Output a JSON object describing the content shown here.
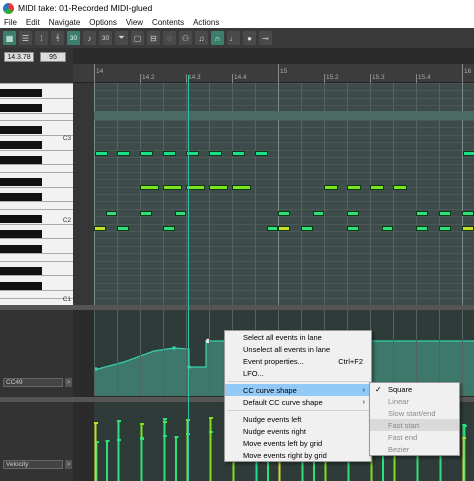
{
  "window": {
    "title": "MIDI take: 01-Recorded MIDI-glued"
  },
  "menubar": [
    "File",
    "Edit",
    "Navigate",
    "Options",
    "View",
    "Contents",
    "Actions"
  ],
  "toolbar": {
    "buttons": [
      {
        "icon": "grid-icon",
        "on": true
      },
      {
        "icon": "list-icon",
        "on": false
      },
      {
        "icon": "dots-icon",
        "on": false
      },
      {
        "icon": "key-icon",
        "on": false
      },
      {
        "icon": "grid30-icon",
        "on": true
      },
      {
        "icon": "note30-icon",
        "on": false
      },
      {
        "icon": "filter30-icon",
        "on": false
      },
      {
        "icon": "funnel-icon",
        "on": false
      },
      {
        "icon": "page-icon",
        "on": false
      },
      {
        "icon": "step-icon",
        "on": false
      },
      {
        "icon": "loop-icon",
        "on": false
      },
      {
        "icon": "nodes-icon",
        "on": false
      },
      {
        "icon": "chord-icon",
        "on": false
      },
      {
        "icon": "magnet-icon",
        "on": true
      },
      {
        "icon": "note-icon",
        "on": false
      },
      {
        "icon": "mic-icon",
        "on": false
      },
      {
        "icon": "tuner-icon",
        "on": false
      }
    ]
  },
  "info": {
    "position": "14.3.78",
    "velocity": "95"
  },
  "ruler": [
    {
      "label": "14",
      "bar": true
    },
    {
      "label": "14.2",
      "bar": false
    },
    {
      "label": "14.3",
      "bar": false
    },
    {
      "label": "14.4",
      "bar": false
    },
    {
      "label": "15",
      "bar": true
    },
    {
      "label": "15.2",
      "bar": false
    },
    {
      "label": "15.3",
      "bar": false
    },
    {
      "label": "15.4",
      "bar": false
    },
    {
      "label": "16",
      "bar": true
    }
  ],
  "keys": {
    "labels": [
      "C3",
      "C2",
      "C1"
    ]
  },
  "notes": [
    {
      "beat": 0.02,
      "len": 0.28,
      "row": 0,
      "color": "#19e08a"
    },
    {
      "beat": 0.5,
      "len": 0.28,
      "row": 0,
      "color": "#19e08a"
    },
    {
      "beat": 1.0,
      "len": 0.28,
      "row": 0,
      "color": "#19e08a"
    },
    {
      "beat": 1.5,
      "len": 0.28,
      "row": 0,
      "color": "#19e08a"
    },
    {
      "beat": 2.0,
      "len": 0.28,
      "row": 0,
      "color": "#19e08a"
    },
    {
      "beat": 2.5,
      "len": 0.28,
      "row": 0,
      "color": "#19e08a"
    },
    {
      "beat": 3.0,
      "len": 0.28,
      "row": 0,
      "color": "#19e08a"
    },
    {
      "beat": 3.5,
      "len": 0.28,
      "row": 0,
      "color": "#19e08a"
    },
    {
      "beat": 8.02,
      "len": 0.28,
      "row": 0,
      "color": "#19e08a"
    },
    {
      "beat": 1.0,
      "len": 0.42,
      "row": 1,
      "color": "#7be31f"
    },
    {
      "beat": 1.5,
      "len": 0.42,
      "row": 1,
      "color": "#7be31f"
    },
    {
      "beat": 2.0,
      "len": 0.42,
      "row": 1,
      "color": "#7be31f"
    },
    {
      "beat": 2.5,
      "len": 0.42,
      "row": 1,
      "color": "#7be31f"
    },
    {
      "beat": 3.0,
      "len": 0.42,
      "row": 1,
      "color": "#7be31f"
    },
    {
      "beat": 5.0,
      "len": 0.3,
      "row": 1,
      "color": "#7be31f"
    },
    {
      "beat": 5.5,
      "len": 0.3,
      "row": 1,
      "color": "#7be31f"
    },
    {
      "beat": 6.0,
      "len": 0.3,
      "row": 1,
      "color": "#7be31f"
    },
    {
      "beat": 6.5,
      "len": 0.3,
      "row": 1,
      "color": "#7be31f"
    },
    {
      "beat": 0.25,
      "len": 0.25,
      "row": 2,
      "color": "#2fe07a"
    },
    {
      "beat": 1.0,
      "len": 0.25,
      "row": 2,
      "color": "#2fe07a"
    },
    {
      "beat": 1.75,
      "len": 0.25,
      "row": 2,
      "color": "#2fe07a"
    },
    {
      "beat": 4.0,
      "len": 0.25,
      "row": 2,
      "color": "#2fe07a"
    },
    {
      "beat": 4.75,
      "len": 0.25,
      "row": 2,
      "color": "#2fe07a"
    },
    {
      "beat": 5.5,
      "len": 0.25,
      "row": 2,
      "color": "#2fe07a"
    },
    {
      "beat": 7.0,
      "len": 0.25,
      "row": 2,
      "color": "#2fe07a"
    },
    {
      "beat": 7.5,
      "len": 0.25,
      "row": 2,
      "color": "#2fe07a"
    },
    {
      "beat": 8.0,
      "len": 0.25,
      "row": 2,
      "color": "#2fe07a"
    },
    {
      "beat": 0.0,
      "len": 0.25,
      "row": 3,
      "color": "#c8df2a"
    },
    {
      "beat": 0.5,
      "len": 0.25,
      "row": 3,
      "color": "#2fe07a"
    },
    {
      "beat": 1.5,
      "len": 0.25,
      "row": 3,
      "color": "#2fe07a"
    },
    {
      "beat": 3.75,
      "len": 0.25,
      "row": 3,
      "color": "#2fe07a"
    },
    {
      "beat": 4.0,
      "len": 0.25,
      "row": 3,
      "color": "#c8df2a"
    },
    {
      "beat": 4.5,
      "len": 0.25,
      "row": 3,
      "color": "#2fe07a"
    },
    {
      "beat": 5.5,
      "len": 0.25,
      "row": 3,
      "color": "#2fe07a"
    },
    {
      "beat": 6.25,
      "len": 0.25,
      "row": 3,
      "color": "#2fe07a"
    },
    {
      "beat": 7.0,
      "len": 0.25,
      "row": 3,
      "color": "#2fe07a"
    },
    {
      "beat": 7.5,
      "len": 0.25,
      "row": 3,
      "color": "#2fe07a"
    },
    {
      "beat": 8.0,
      "len": 0.25,
      "row": 3,
      "color": "#c8df2a"
    }
  ],
  "cc_lane": {
    "label": "CC49",
    "arrow": ">"
  },
  "velocity_lane": {
    "label": "Velocity",
    "arrow": ">"
  },
  "context_menu": {
    "items": [
      {
        "label": "Select all events in lane",
        "shortcut": "",
        "submenu": false,
        "highlighted": false
      },
      {
        "label": "Unselect all events in lane",
        "shortcut": "",
        "submenu": false,
        "highlighted": false
      },
      {
        "label": "Event properties...",
        "shortcut": "Ctrl+F2",
        "submenu": false,
        "highlighted": false
      },
      {
        "label": "LFO...",
        "shortcut": "",
        "submenu": false,
        "highlighted": false
      },
      {
        "sep": true
      },
      {
        "label": "CC curve shape",
        "shortcut": "",
        "submenu": true,
        "highlighted": true
      },
      {
        "label": "Default CC curve shape",
        "shortcut": "",
        "submenu": true,
        "highlighted": false
      },
      {
        "sep": true
      },
      {
        "label": "Nudge events left",
        "shortcut": "",
        "submenu": false,
        "highlighted": false
      },
      {
        "label": "Nudge events right",
        "shortcut": "",
        "submenu": false,
        "highlighted": false
      },
      {
        "label": "Move events left by grid",
        "shortcut": "",
        "submenu": false,
        "highlighted": false
      },
      {
        "label": "Move events right by grid",
        "shortcut": "",
        "submenu": false,
        "highlighted": false
      }
    ]
  },
  "submenu": {
    "items": [
      {
        "label": "Square",
        "checked": true,
        "disabled": false,
        "highlighted": false
      },
      {
        "label": "Linear",
        "checked": false,
        "disabled": true,
        "highlighted": false
      },
      {
        "label": "Slow start/end",
        "checked": false,
        "disabled": true,
        "highlighted": false
      },
      {
        "label": "Fast start",
        "checked": false,
        "disabled": true,
        "highlighted": true
      },
      {
        "label": "Fast end",
        "checked": false,
        "disabled": true,
        "highlighted": false
      },
      {
        "label": "Bezier",
        "checked": false,
        "disabled": true,
        "highlighted": false
      }
    ]
  },
  "colors": {
    "accent": "#31c2a6",
    "grid_bg": "#3d4c4a",
    "lane_bg": "#2f3b39"
  }
}
